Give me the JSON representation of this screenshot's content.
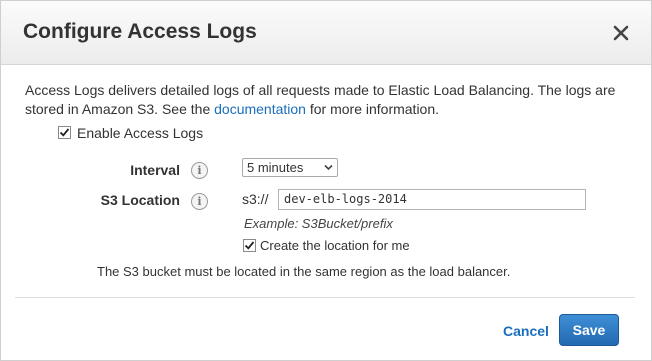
{
  "dialog": {
    "title": "Configure Access Logs",
    "close_icon": "close-icon"
  },
  "description": {
    "before_link": "Access Logs delivers detailed logs of all requests made to Elastic Load Balancing. The logs are stored in Amazon S3. See the ",
    "link_text": "documentation",
    "after_link": " for more information."
  },
  "enable": {
    "label": "Enable Access Logs",
    "checked": true
  },
  "interval": {
    "label": "Interval",
    "info_icon": "info-icon",
    "selected": "5 minutes"
  },
  "s3_location": {
    "label": "S3 Location",
    "info_icon": "info-icon",
    "prefix": "s3://",
    "value": "dev-elb-logs-2014",
    "example": "Example: S3Bucket/prefix",
    "create_label": "Create the location for me",
    "create_checked": true
  },
  "note": "The S3 bucket must be located in the same region as the load balancer.",
  "footer": {
    "cancel_label": "Cancel",
    "save_label": "Save"
  },
  "colors": {
    "link": "#1a6ebb",
    "primary_button": "#2f7cc4"
  }
}
